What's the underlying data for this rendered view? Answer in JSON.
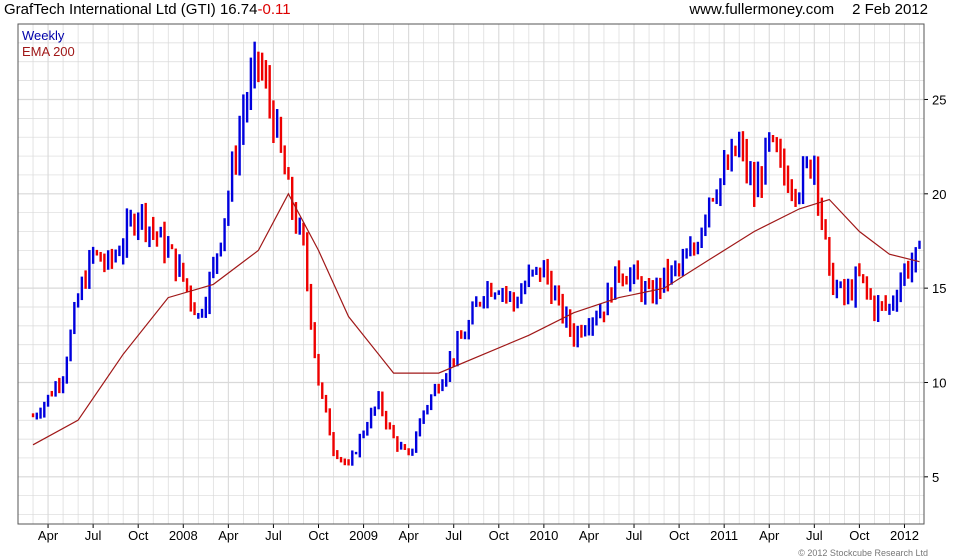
{
  "header": {
    "company": "GrafTech International Ltd",
    "ticker": "(GTI)",
    "last": "16.74",
    "change": "-0.11",
    "site": "www.fullermoney.com",
    "date": "2 Feb 2012"
  },
  "footer": {
    "copyright": "© 2012 Stockcube Research Ltd"
  },
  "colors": {
    "up": "#0000dd",
    "down": "#ee0000",
    "ema": "#a01818",
    "grid": "#d9d9d9",
    "axis": "#000000",
    "legend_weekly": "#0000aa",
    "legend_ema": "#a01818"
  },
  "chart_data": {
    "type": "line",
    "subtype": "weekly candlestick/bar price chart with moving average",
    "series": [
      {
        "name": "Weekly",
        "style": "bars (blue up, red down)",
        "x": [
          "2007-03",
          "2007-04",
          "2007-05",
          "2007-06",
          "2007-07",
          "2007-08",
          "2007-09",
          "2007-10",
          "2007-11",
          "2007-12",
          "2008-01",
          "2008-02",
          "2008-03",
          "2008-04",
          "2008-05",
          "2008-06",
          "2008-07",
          "2008-08",
          "2008-09",
          "2008-10",
          "2008-11",
          "2008-12",
          "2009-01",
          "2009-02",
          "2009-03",
          "2009-04",
          "2009-05",
          "2009-06",
          "2009-07",
          "2009-08",
          "2009-09",
          "2009-10",
          "2009-11",
          "2009-12",
          "2010-01",
          "2010-02",
          "2010-03",
          "2010-04",
          "2010-05",
          "2010-06",
          "2010-07",
          "2010-08",
          "2010-09",
          "2010-10",
          "2010-11",
          "2010-12",
          "2011-01",
          "2011-02",
          "2011-03",
          "2011-04",
          "2011-05",
          "2011-06",
          "2011-07",
          "2011-08",
          "2011-09",
          "2011-10",
          "2011-11",
          "2011-12",
          "2012-01",
          "2012-02"
        ],
        "values": [
          8.2,
          9.2,
          10.5,
          14.5,
          16.8,
          16.2,
          17.5,
          19.2,
          18.0,
          17.0,
          15.5,
          13.5,
          16.0,
          20.0,
          24.5,
          27.0,
          24.0,
          20.0,
          17.0,
          10.0,
          6.5,
          5.5,
          7.5,
          9.0,
          7.0,
          6.0,
          8.5,
          10.0,
          11.5,
          13.0,
          15.0,
          15.2,
          14.2,
          15.5,
          16.0,
          14.0,
          12.5,
          13.5,
          14.0,
          16.0,
          15.5,
          14.5,
          15.5,
          16.0,
          17.0,
          20.0,
          21.0,
          22.5,
          20.0,
          22.5,
          21.0,
          20.5,
          22.0,
          15.5,
          14.5,
          15.5,
          14.0,
          14.0,
          16.0,
          16.74
        ]
      },
      {
        "name": "EMA 200",
        "style": "line",
        "x": [
          "2007-03",
          "2007-06",
          "2007-09",
          "2007-12",
          "2008-03",
          "2008-06",
          "2008-08",
          "2008-10",
          "2008-12",
          "2009-03",
          "2009-06",
          "2009-09",
          "2009-12",
          "2010-03",
          "2010-06",
          "2010-09",
          "2010-12",
          "2011-03",
          "2011-06",
          "2011-08",
          "2011-10",
          "2011-12",
          "2012-02"
        ],
        "values": [
          6.7,
          8.0,
          11.5,
          14.5,
          15.2,
          17.0,
          20.0,
          17.0,
          13.5,
          10.5,
          10.5,
          11.5,
          12.5,
          13.7,
          14.5,
          15.0,
          16.5,
          18.0,
          19.2,
          19.7,
          18.0,
          16.8,
          16.4
        ]
      }
    ],
    "x_ticks": [
      "Apr",
      "Jul",
      "Oct",
      "2008",
      "Apr",
      "Jul",
      "Oct",
      "2009",
      "Apr",
      "Jul",
      "Oct",
      "2010",
      "Apr",
      "Jul",
      "Oct",
      "2011",
      "Apr",
      "Jul",
      "Oct",
      "2012"
    ],
    "y_ticks": [
      5,
      10,
      15,
      20,
      25
    ],
    "ylim": [
      2.5,
      29
    ],
    "y_axis_side": "right",
    "legend": [
      "Weekly",
      "EMA 200"
    ],
    "legend_position": "top-left",
    "grid": true
  }
}
